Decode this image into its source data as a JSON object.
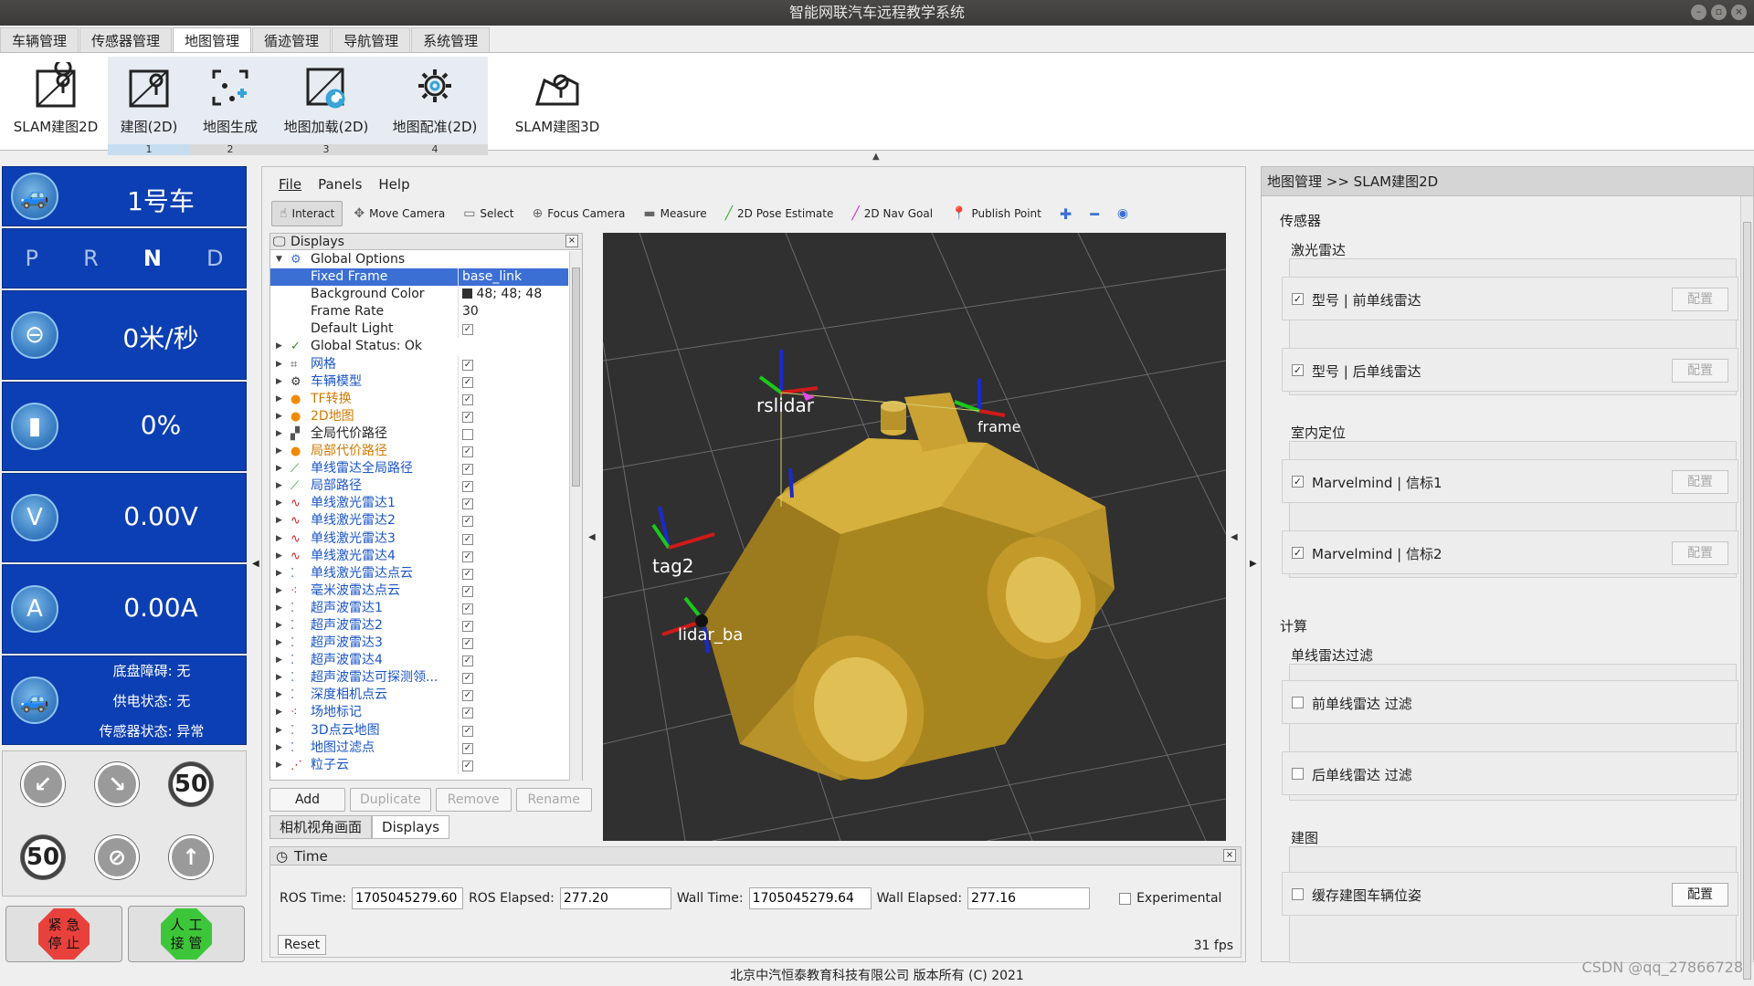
{
  "window": {
    "title": "智能网联汽车远程教学系统"
  },
  "menu_tabs": [
    "车辆管理",
    "传感器管理",
    "地图管理",
    "循迹管理",
    "导航管理",
    "系统管理"
  ],
  "ribbon": {
    "btn1": "SLAM建图2D",
    "btn2": "建图(2D)",
    "btn2_num": "1",
    "btn3": "地图生成",
    "btn3_num": "2",
    "btn4": "地图加载(2D)",
    "btn4_num": "3",
    "btn5": "地图配准(2D)",
    "btn5_num": "4",
    "btn6": "SLAM建图3D"
  },
  "left": {
    "car_name": "1号车",
    "gears": [
      "P",
      "R",
      "N",
      "D"
    ],
    "selected_gear": "N",
    "speed": "0米/秒",
    "battery": "0%",
    "voltage": "0.00V",
    "current": "0.00A",
    "status": {
      "line1": "底盘障碍: 无",
      "line2": "供电状态: 无",
      "line3": "传感器状态: 异常"
    },
    "signs": [
      "50",
      "50"
    ],
    "emergency": "紧 急\n停 止",
    "manual": "人 工\n接 管"
  },
  "rviz": {
    "menu": {
      "file": "File",
      "panels": "Panels",
      "help": "Help"
    },
    "tools": {
      "interact": "Interact",
      "move_camera": "Move Camera",
      "select": "Select",
      "focus_camera": "Focus Camera",
      "measure": "Measure",
      "pose_estimate": "2D Pose Estimate",
      "nav_goal": "2D Nav Goal",
      "publish_point": "Publish Point"
    },
    "displays_title": "Displays",
    "global_options": "Global Options",
    "fixed_frame_label": "Fixed Frame",
    "fixed_frame_value": "base_link",
    "bg_color_label": "Background Color",
    "bg_color_value": "48; 48; 48",
    "frame_rate_label": "Frame Rate",
    "frame_rate_value": "30",
    "default_light_label": "Default Light",
    "global_status": "Global Status: Ok",
    "items": [
      {
        "name": "网格",
        "style": "blue",
        "checked": true
      },
      {
        "name": "车辆模型",
        "style": "blue",
        "checked": true
      },
      {
        "name": "TF转换",
        "style": "orange",
        "checked": true
      },
      {
        "name": "2D地图",
        "style": "orange",
        "checked": true
      },
      {
        "name": "全局代价路径",
        "style": "plain",
        "checked": false
      },
      {
        "name": "局部代价路径",
        "style": "orange",
        "checked": true
      },
      {
        "name": "单线雷达全局路径",
        "style": "blue",
        "checked": true
      },
      {
        "name": "局部路径",
        "style": "blue",
        "checked": true
      },
      {
        "name": "单线激光雷达1",
        "style": "blue",
        "checked": true
      },
      {
        "name": "单线激光雷达2",
        "style": "blue",
        "checked": true
      },
      {
        "name": "单线激光雷达3",
        "style": "blue",
        "checked": true
      },
      {
        "name": "单线激光雷达4",
        "style": "blue",
        "checked": true
      },
      {
        "name": "单线激光雷达点云",
        "style": "blue",
        "checked": true
      },
      {
        "name": "毫米波雷达点云",
        "style": "blue",
        "checked": true
      },
      {
        "name": "超声波雷达1",
        "style": "blue",
        "checked": true
      },
      {
        "name": "超声波雷达2",
        "style": "blue",
        "checked": true
      },
      {
        "name": "超声波雷达3",
        "style": "blue",
        "checked": true
      },
      {
        "name": "超声波雷达4",
        "style": "blue",
        "checked": true
      },
      {
        "name": "超声波雷达可探测领...",
        "style": "blue",
        "checked": true
      },
      {
        "name": "深度相机点云",
        "style": "blue",
        "checked": true
      },
      {
        "name": "场地标记",
        "style": "blue",
        "checked": true
      },
      {
        "name": "3D点云地图",
        "style": "blue",
        "checked": true
      },
      {
        "name": "地图过滤点",
        "style": "blue",
        "checked": true
      },
      {
        "name": "粒子云",
        "style": "blue",
        "checked": true
      }
    ],
    "buttons": {
      "add": "Add",
      "duplicate": "Duplicate",
      "remove": "Remove",
      "rename": "Rename"
    },
    "bottom_tabs": [
      "相机视角画面",
      "Displays"
    ],
    "scene_labels": {
      "rslidar": "rslidar",
      "frame": "frame",
      "tag2": "tag2",
      "lidar": "lidar_ba"
    },
    "time": {
      "title": "Time",
      "ros_time_label": "ROS Time:",
      "ros_time": "1705045279.60",
      "ros_elapsed_label": "ROS Elapsed:",
      "ros_elapsed": "277.20",
      "wall_time_label": "Wall Time:",
      "wall_time": "1705045279.64",
      "wall_elapsed_label": "Wall Elapsed:",
      "wall_elapsed": "277.16",
      "experimental": "Experimental",
      "reset": "Reset",
      "fps": "31 fps"
    }
  },
  "right": {
    "breadcrumb": "地图管理 >> SLAM建图2D",
    "sensor": "传感器",
    "lidar": "激光雷达",
    "lidar_items": [
      "型号 | 前单线雷达",
      "型号 | 后单线雷达"
    ],
    "indoor": "室内定位",
    "indoor_items": [
      "Marvelmind | 信标1",
      "Marvelmind | 信标2"
    ],
    "compute": "计算",
    "filter": "单线雷达过滤",
    "filter_items": [
      "前单线雷达 过滤",
      "后单线雷达 过滤"
    ],
    "mapping": "建图",
    "mapping_items": [
      "缓存建图车辆位姿"
    ],
    "config_label": "配置"
  },
  "footer": "北京中汽恒泰教育科技有限公司 版本所有 (C) 2021",
  "watermark": "CSDN @qq_27866728"
}
